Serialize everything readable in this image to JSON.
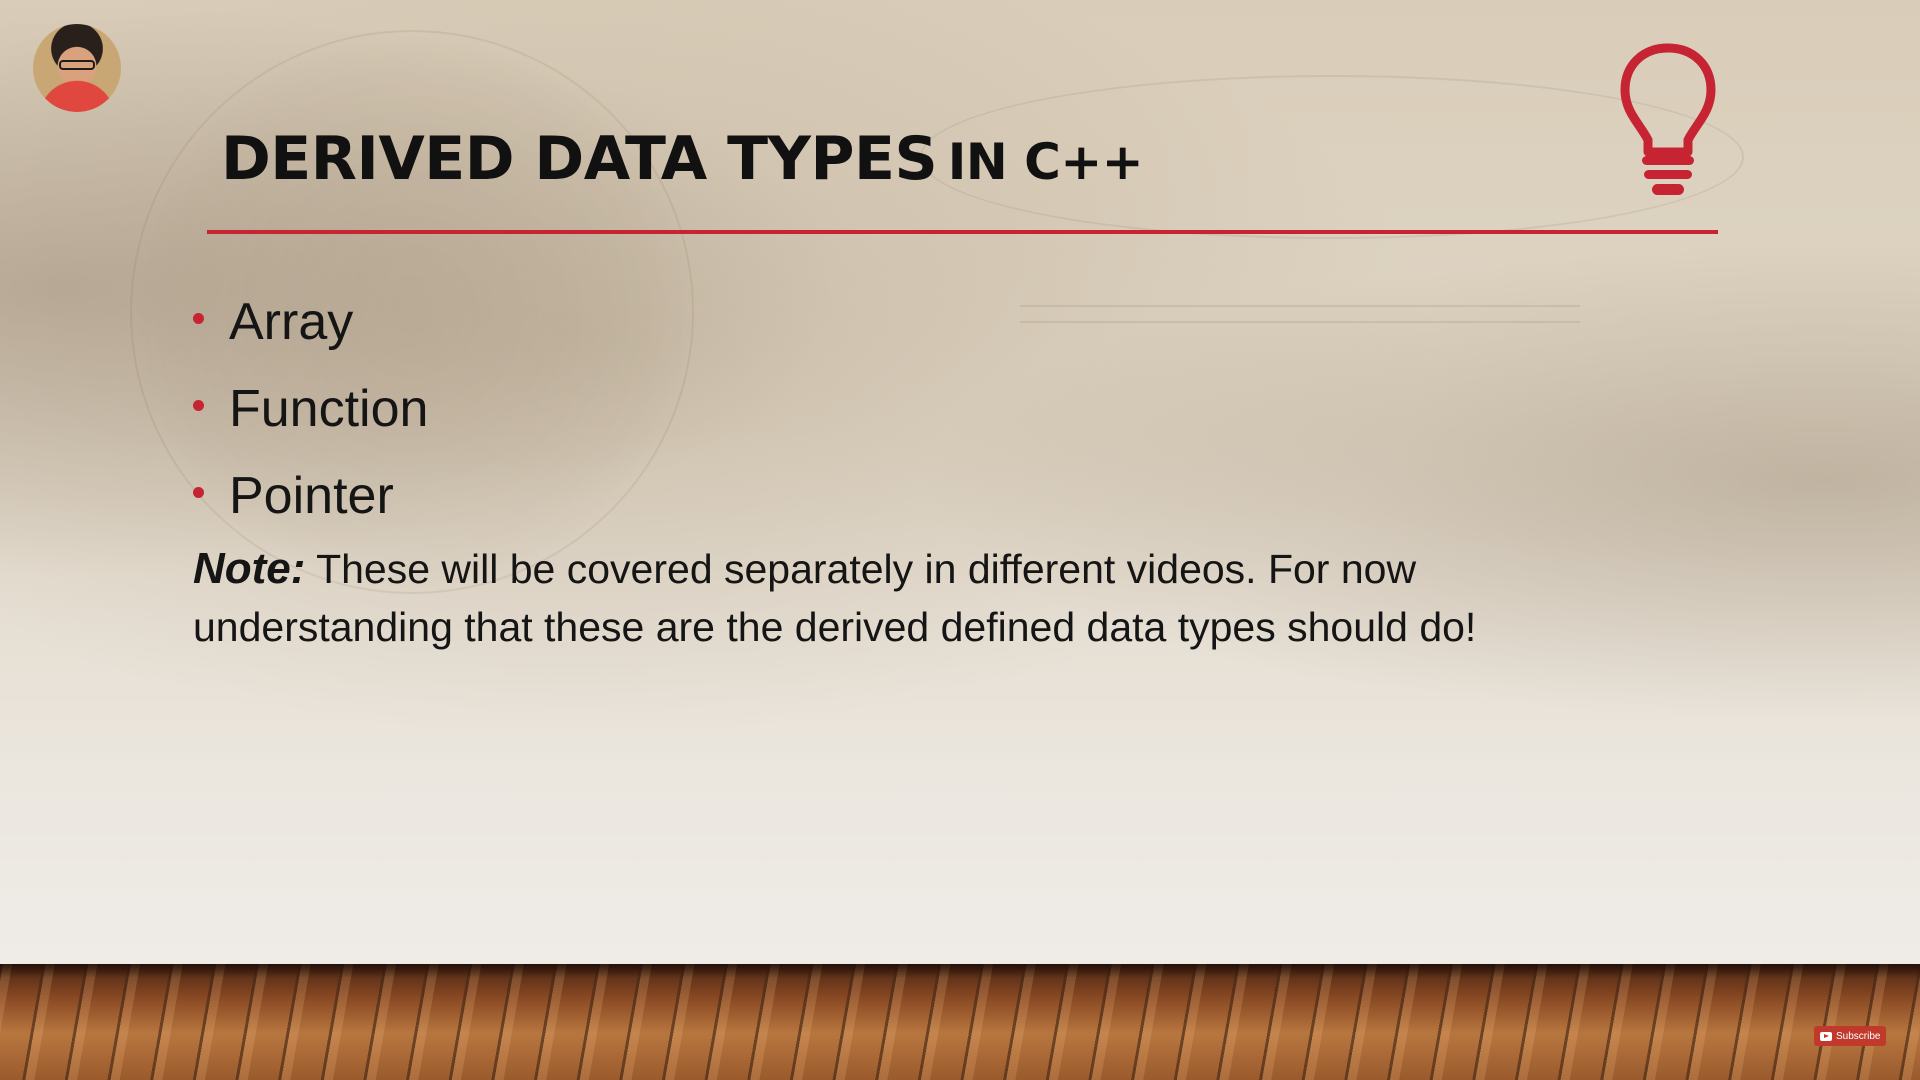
{
  "slide": {
    "title_main": "DERIVED DATA TYPES",
    "title_sub": "IN C++",
    "bullets": [
      "Array",
      "Function",
      "Pointer"
    ],
    "note_label": "Note:",
    "note_text": " These will be covered separately in different videos. For now understanding that these are the derived defined data types should do!"
  },
  "overlay": {
    "subscribe_label": "Subscribe"
  },
  "colors": {
    "accent": "#c62333",
    "text": "#151515"
  },
  "icons": [
    "lightbulb-icon",
    "youtube-icon"
  ]
}
